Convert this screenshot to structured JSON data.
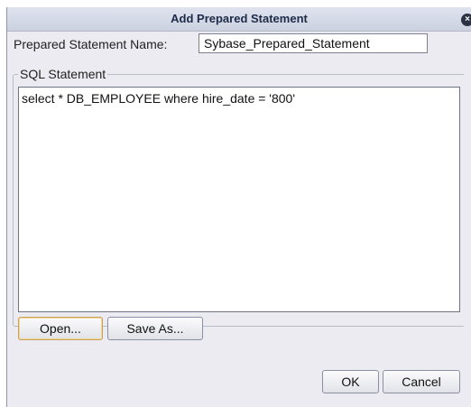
{
  "dialog": {
    "title": "Add Prepared Statement",
    "close_glyph": "×"
  },
  "form": {
    "name_label": "Prepared Statement Name:",
    "name_value": "Sybase_Prepared_Statement",
    "group_label": "SQL Statement",
    "sql_value": "select * DB_EMPLOYEE where hire_date = '800'"
  },
  "buttons": {
    "open": "Open...",
    "save_as": "Save As...",
    "ok": "OK",
    "cancel": "Cancel"
  },
  "icons": {
    "close": "close-icon"
  }
}
